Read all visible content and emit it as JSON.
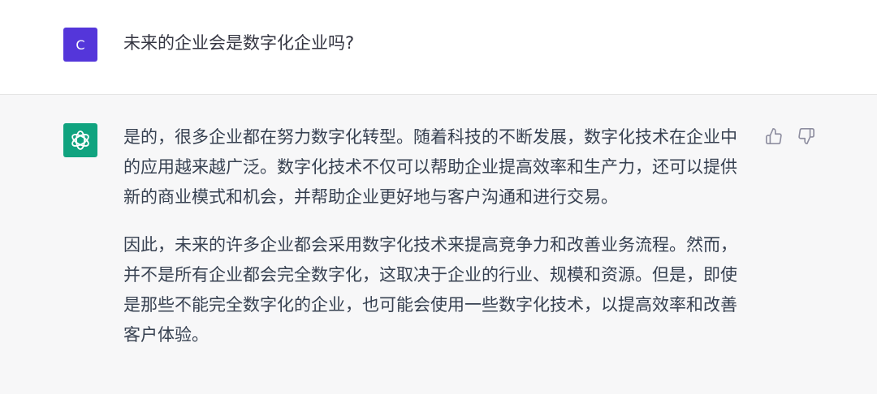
{
  "user_message": {
    "avatar_letter": "C",
    "text": "未来的企业会是数字化企业吗?"
  },
  "assistant_message": {
    "avatar_icon": "openai-logo-icon",
    "paragraphs": [
      "是的，很多企业都在努力数字化转型。随着科技的不断发展，数字化技术在企业中的应用越来越广泛。数字化技术不仅可以帮助企业提高效率和生产力，还可以提供新的商业模式和机会，并帮助企业更好地与客户沟通和进行交易。",
      "因此，未来的许多企业都会采用数字化技术来提高竞争力和改善业务流程。然而，并不是所有企业都会完全数字化，这取决于企业的行业、规模和资源。但是，即使是那些不能完全数字化的企业，也可能会使用一些数字化技术，以提高效率和改善客户体验。"
    ],
    "feedback_icons": [
      "thumbs-up-icon",
      "thumbs-down-icon"
    ]
  },
  "colors": {
    "user_avatar_bg": "#5436da",
    "assistant_avatar_bg": "#10a37f",
    "assistant_row_bg": "#f7f7f8"
  }
}
